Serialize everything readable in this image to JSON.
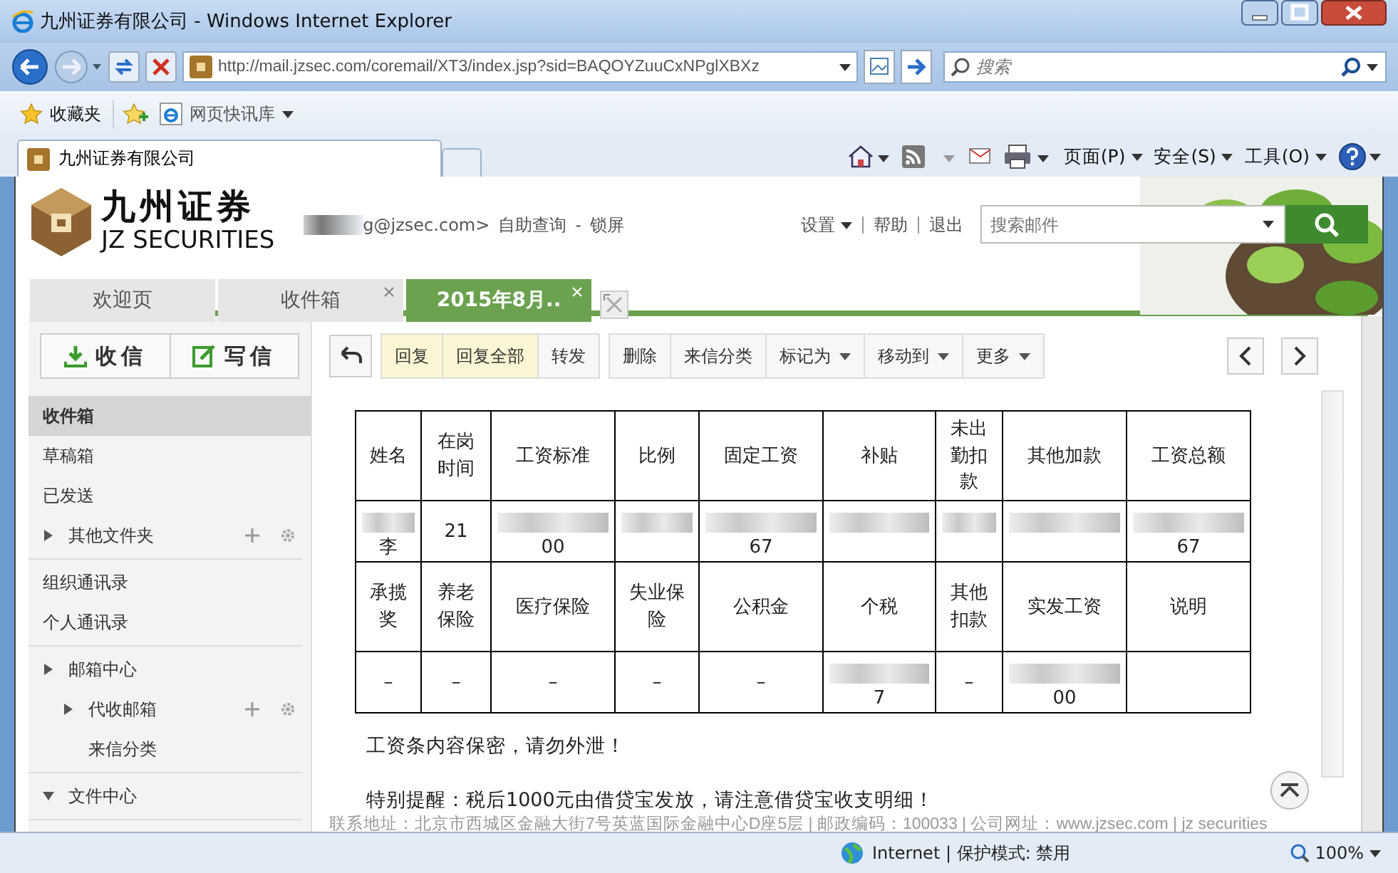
{
  "window": {
    "title": "九州证券有限公司 - Windows Internet Explorer"
  },
  "address_bar": {
    "url": "http://mail.jzsec.com/coremail/XT3/index.jsp?sid=BAQOYZuuCxNPglXBXz",
    "search_placeholder": "搜索"
  },
  "favorites_bar": {
    "favorites": "收藏夹",
    "web_slice": "网页快讯库"
  },
  "browser_tabs": [
    {
      "title": "九州证券有限公司",
      "selected": true
    }
  ],
  "command_bar": [
    {
      "label": "页面(P)"
    },
    {
      "label": "安全(S)"
    },
    {
      "label": "工具(O)"
    }
  ],
  "mail_header": {
    "logo_cn": "九州证券",
    "logo_en": "JZ SECURITIES",
    "user": "g@jzsec.com>",
    "links": [
      "自助查询",
      "锁屏"
    ],
    "separator": "-",
    "menu": [
      {
        "label": "设置",
        "dropdown": true
      },
      {
        "label": "帮助",
        "dropdown": false
      },
      {
        "label": "退出",
        "dropdown": false
      }
    ],
    "search_placeholder": "搜索邮件"
  },
  "mail_tabs": [
    {
      "label": "欢迎页",
      "closable": false,
      "selected": false
    },
    {
      "label": "收件箱",
      "closable": true,
      "selected": false
    },
    {
      "label": "2015年8月..",
      "closable": true,
      "selected": true
    }
  ],
  "sidebar": {
    "actions": [
      "收信",
      "写信"
    ],
    "groups": [
      [
        {
          "label": "收件箱",
          "selected": true
        },
        {
          "label": "草稿箱",
          "selected": false
        },
        {
          "label": "已发送",
          "selected": false
        },
        {
          "label": "其他文件夹",
          "selected": false,
          "expanded": false,
          "actions": true
        }
      ],
      [
        {
          "label": "组织通讯录",
          "selected": false
        },
        {
          "label": "个人通讯录",
          "selected": false
        }
      ],
      [
        {
          "label": "邮箱中心",
          "selected": false,
          "expanded": false,
          "children": [
            {
              "label": "代收邮箱",
              "selected": false,
              "expanded": false,
              "actions": true
            },
            {
              "label": "来信分类",
              "selected": false
            }
          ]
        }
      ],
      [
        {
          "label": "文件中心",
          "selected": false,
          "expanded": true
        }
      ]
    ]
  },
  "toolbar": {
    "groups": [
      [
        {
          "label": "回复",
          "highlighted": true,
          "dropdown": false
        },
        {
          "label": "回复全部",
          "highlighted": true,
          "dropdown": false
        },
        {
          "label": "转发",
          "highlighted": false,
          "dropdown": false
        }
      ],
      [
        {
          "label": "删除",
          "highlighted": false,
          "dropdown": false
        },
        {
          "label": "来信分类",
          "highlighted": false,
          "dropdown": false
        },
        {
          "label": "标记为",
          "highlighted": false,
          "dropdown": true
        },
        {
          "label": "移动到",
          "highlighted": false,
          "dropdown": true
        },
        {
          "label": "更多",
          "highlighted": false,
          "dropdown": true
        }
      ]
    ]
  },
  "message": {
    "table": {
      "rows": [
        [
          {
            "text": "姓名"
          },
          {
            "text": "在岗时间"
          },
          {
            "text": "工资标准"
          },
          {
            "text": "比例"
          },
          {
            "text": "固定工资"
          },
          {
            "text": "补贴"
          },
          {
            "text": "未出勤扣款"
          },
          {
            "text": "其他加款"
          },
          {
            "text": "工资总额"
          }
        ],
        [
          {
            "text": "李",
            "redacted": true
          },
          {
            "text": "21"
          },
          {
            "text": "00",
            "redacted": true
          },
          {
            "text": "",
            "redacted": true
          },
          {
            "text": "67",
            "redacted": true
          },
          {
            "text": "",
            "redacted": true
          },
          {
            "text": "",
            "redacted": true
          },
          {
            "text": "",
            "redacted": true
          },
          {
            "text": "67",
            "redacted": true
          }
        ],
        [
          {
            "text": "承揽奖"
          },
          {
            "text": "养老保险"
          },
          {
            "text": "医疗保险"
          },
          {
            "text": "失业保险"
          },
          {
            "text": "公积金"
          },
          {
            "text": "个税"
          },
          {
            "text": "其他扣款"
          },
          {
            "text": "实发工资"
          },
          {
            "text": "说明"
          }
        ],
        [
          {
            "text": "–"
          },
          {
            "text": "–"
          },
          {
            "text": "–"
          },
          {
            "text": "–"
          },
          {
            "text": "–"
          },
          {
            "text": "7",
            "redacted": true
          },
          {
            "text": "–"
          },
          {
            "text": "00",
            "redacted": true
          },
          {
            "text": ""
          }
        ]
      ]
    },
    "paragraphs": [
      "工资条内容保密，请勿外泄！",
      "特别提醒：税后1000元由借贷宝发放，请注意借贷宝收支明细！"
    ],
    "footer": "联系地址：北京市西城区金融大街7号英蓝国际金融中心D座5层 | 邮政编码：100033 | 公司网址：www.jzsec.com | jz securities"
  },
  "status_bar": {
    "zone": "Internet | 保护模式: 禁用",
    "zoom": "100%"
  }
}
